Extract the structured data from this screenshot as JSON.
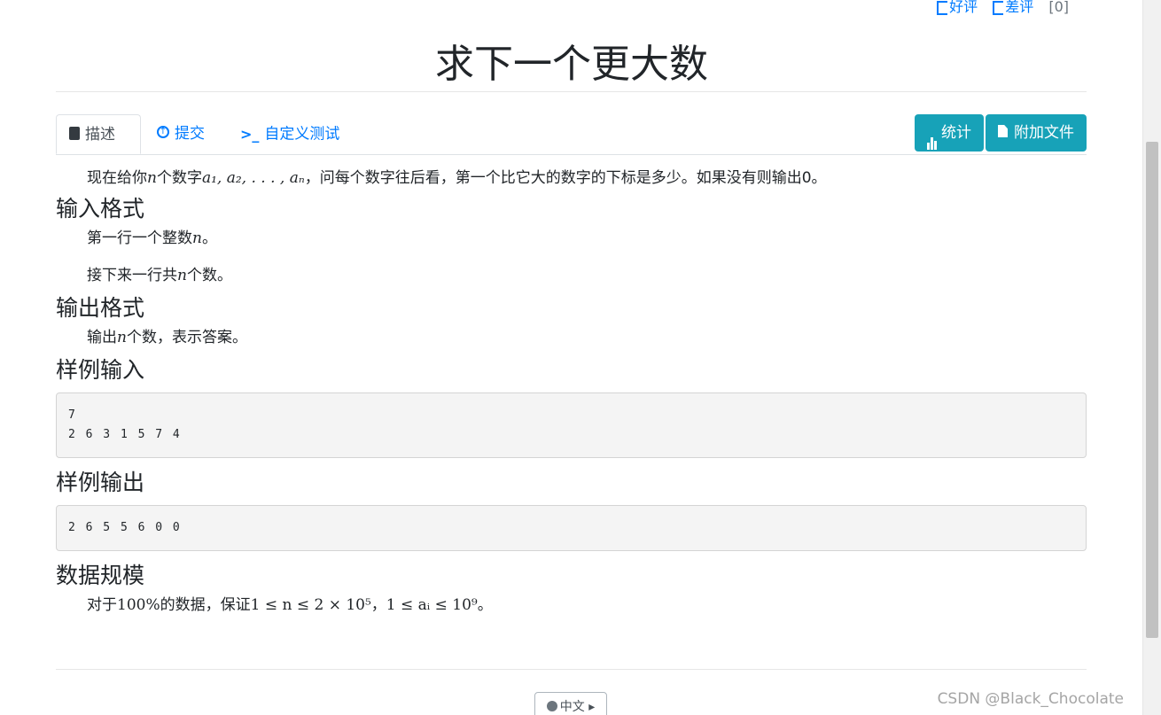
{
  "vote": {
    "like": "好评",
    "dislike": "差评",
    "count": "[0]"
  },
  "title": "求下一个更大数",
  "tabs": [
    {
      "label": "描述",
      "icon": "book-icon"
    },
    {
      "label": "提交",
      "icon": "upload-circle-icon"
    },
    {
      "label": "自定义测试",
      "icon": "terminal-icon"
    }
  ],
  "buttons": {
    "stats": "统计",
    "attachments": "附加文件"
  },
  "description": {
    "p1_a": "现在给你",
    "p1_n": "n",
    "p1_b": "个数字",
    "p1_seq": "a₁, a₂, . . . , aₙ",
    "p1_c": "，问每个数字往后看，第一个比它大的数字的下标是多少。如果没有则输出0。"
  },
  "input_format": {
    "heading": "输入格式",
    "line1_a": "第一行一个整数",
    "line1_n": "n",
    "line1_b": "。",
    "line2_a": "接下来一行共",
    "line2_n": "n",
    "line2_b": "个数。"
  },
  "output_format": {
    "heading": "输出格式",
    "line1_a": "输出",
    "line1_n": "n",
    "line1_b": "个数，表示答案。"
  },
  "sample_input": {
    "heading": "样例输入",
    "content": "7\n2 6 3 1 5 7 4"
  },
  "sample_output": {
    "heading": "样例输出",
    "content": "2 6 5 5 6 0 0"
  },
  "constraints": {
    "heading": "数据规模",
    "a": "对于",
    "pct": "100%",
    "b": "的数据，保证",
    "f1": "1 ≤ n ≤ 2 × 10⁵",
    "sep": "，",
    "f2": "1 ≤ aᵢ ≤ 10⁹",
    "end": "。"
  },
  "language": "中文",
  "watermark": "CSDN @Black_Chocolate"
}
